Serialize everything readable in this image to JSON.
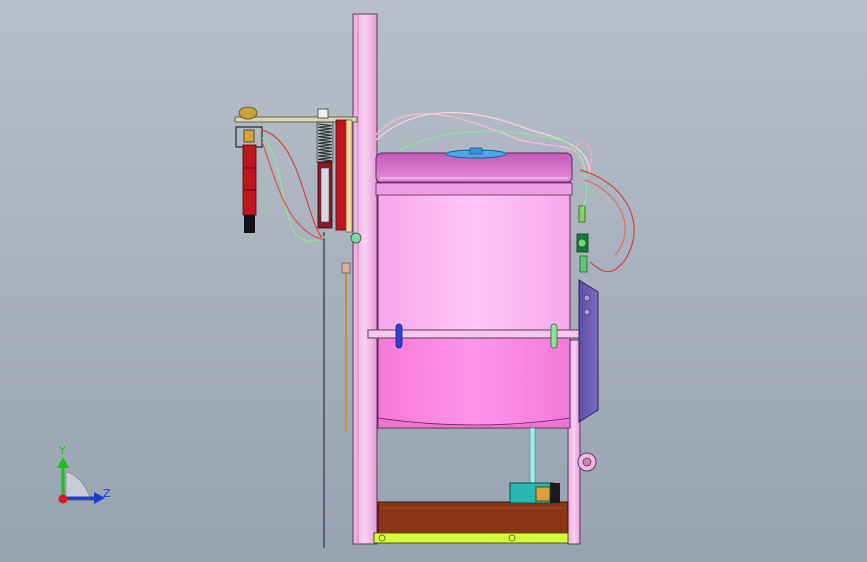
{
  "view": {
    "background_top": "#b7c0ca",
    "background_bottom": "#96a3b0"
  },
  "triad": {
    "y_label": "Y",
    "z_label": "Z",
    "y_color": "#22bb22",
    "z_color": "#1a3fd6",
    "x_color": "#d61a1a"
  },
  "colors": {
    "frame_pink": "#f3b8e6",
    "tank_upper": "#ffc0f5",
    "tank_lower": "#ff8ee8",
    "tank_lid": "#e07ad3",
    "side_plate": "#6a5bb0",
    "base_brown": "#8a3418",
    "base_yellow": "#d9ff3a",
    "pump_teal": "#27b8b0",
    "sensor_red": "#c0141e",
    "wire_red": "#d84040",
    "wire_green": "#8fe39a",
    "wire_pink": "#ffb8d8"
  }
}
